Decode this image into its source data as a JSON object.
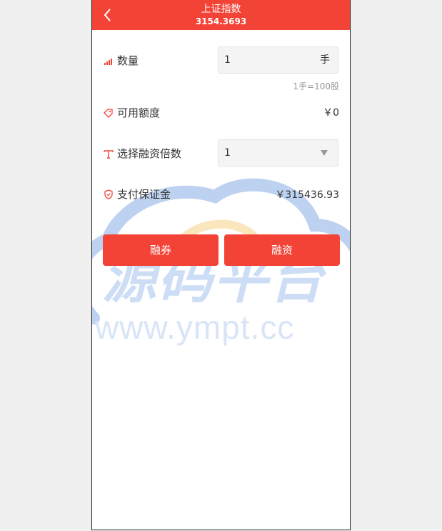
{
  "header": {
    "title": "上证指数",
    "subtitle": "3154.3693"
  },
  "quantity": {
    "label": "数量",
    "value": "1",
    "unit": "手",
    "hint": "1手=100股"
  },
  "available": {
    "label": "可用额度",
    "value": "￥0"
  },
  "leverage": {
    "label": "选择融资倍数",
    "selected": "1"
  },
  "margin": {
    "label": "支付保证金",
    "value": "￥315436.93"
  },
  "buttons": {
    "short_label": "融券",
    "long_label": "融资"
  },
  "watermark": {
    "text": "源码平台",
    "url": "www.ympt.cc"
  },
  "colors": {
    "accent": "#f34336",
    "background": "#f0f0f0"
  },
  "icons": {
    "back": "chevron-left-icon",
    "quantity": "signal-bars-icon",
    "available": "tag-icon",
    "leverage": "text-t-icon",
    "margin": "shield-icon"
  }
}
